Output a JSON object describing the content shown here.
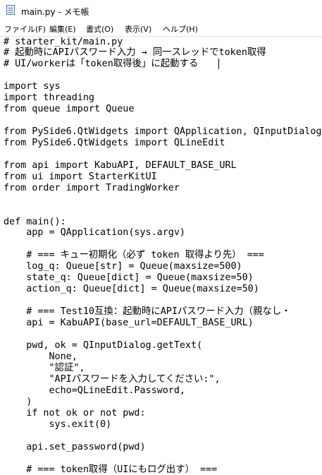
{
  "window": {
    "title": "main.py - メモ帳"
  },
  "menubar": {
    "items": [
      {
        "label": "ファイル(F)"
      },
      {
        "label": "編集(E)"
      },
      {
        "label": "書式(O)"
      },
      {
        "label": "表示(V)"
      },
      {
        "label": "ヘルプ(H)"
      }
    ]
  },
  "editor": {
    "lines": [
      "# starter_kit/main.py",
      "# 起動時にAPIパスワード入力 → 同一スレッドでtoken取得",
      "# UI/workerは「token取得後」に起動する",
      "",
      "import sys",
      "import threading",
      "from queue import Queue",
      "",
      "from PySide6.QtWidgets import QApplication, QInputDialog",
      "from PySide6.QtWidgets import QLineEdit",
      "",
      "from api import KabuAPI, DEFAULT_BASE_URL",
      "from ui import StarterKitUI",
      "from order import TradingWorker",
      "",
      "",
      "def main():",
      "    app = QApplication(sys.argv)",
      "",
      "    # === キュー初期化（必ず token 取得より先） ===",
      "    log_q: Queue[str] = Queue(maxsize=500)",
      "    state_q: Queue[dict] = Queue(maxsize=50)",
      "    action_q: Queue[dict] = Queue(maxsize=50)",
      "",
      "    # === Test10互換：起動時にAPIパスワード入力（親なし・",
      "    api = KabuAPI(base_url=DEFAULT_BASE_URL)",
      "",
      "    pwd, ok = QInputDialog.getText(",
      "        None,",
      "        \"認証\",",
      "        \"APIパスワードを入力してください:\",",
      "        echo=QLineEdit.Password,",
      "    )",
      "    if not ok or not pwd:",
      "        sys.exit(0)",
      "",
      "    api.set_password(pwd)",
      "",
      "    # === token取得（UIにもログ出す） ==="
    ]
  }
}
